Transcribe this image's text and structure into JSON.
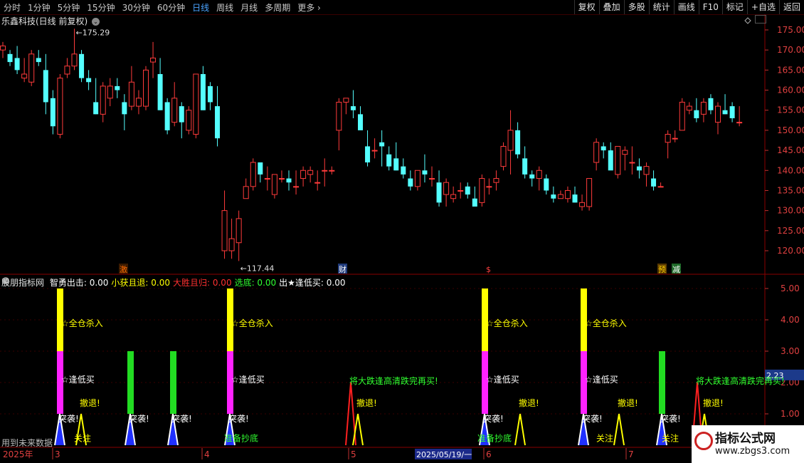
{
  "toolbar": {
    "timeframes": [
      "分时",
      "1分钟",
      "5分钟",
      "15分钟",
      "30分钟",
      "60分钟",
      "日线",
      "周线",
      "月线",
      "多周期",
      "更多"
    ],
    "active": "日线",
    "buttons": [
      "复权",
      "叠加",
      "多股",
      "统计",
      "画线",
      "F10",
      "标记",
      "+自选",
      "返回"
    ]
  },
  "title": "乐鑫科技(日线 前复权)",
  "main_chart": {
    "y_ticks": [
      "175.00",
      "170.00",
      "165.00",
      "160.00",
      "155.00",
      "150.00",
      "145.00",
      "140.00",
      "135.00",
      "130.00",
      "125.00",
      "120.00"
    ],
    "high_label": "175.29",
    "low_label": "117.44",
    "markers": [
      {
        "text": "激",
        "color": "#ff6a00",
        "bg": "#3a1a00"
      },
      {
        "text": "财",
        "color": "#ffffff",
        "bg": "#1f3a7a"
      },
      {
        "text": "$",
        "color": "#ff4040",
        "bg": "#000000"
      },
      {
        "text": "预",
        "color": "#ffd000",
        "bg": "#5a3a00"
      },
      {
        "text": "减",
        "color": "#ffffff",
        "bg": "#1f6a2a"
      }
    ]
  },
  "indicator": {
    "title": "股朋指标网",
    "items": [
      {
        "name": "智勇出击",
        "value": "0.00",
        "color": "#ffffff"
      },
      {
        "name": "小获且退",
        "value": "0.00",
        "color": "#ffff00"
      },
      {
        "name": "大胜且归",
        "value": "0.00",
        "color": "#ff3030"
      },
      {
        "name": "选底",
        "value": "0.00",
        "color": "#30ff30"
      },
      {
        "name": "出★逢低买",
        "value": "0.00",
        "color": "#ffffff"
      }
    ],
    "y_ticks": [
      "5.00",
      "4.00",
      "3.00",
      "2.00",
      "1.00"
    ],
    "current_value": "2.23",
    "labels": {
      "kill": "☆全仓杀入",
      "buy_low": "☆逢低买",
      "raid": "突袭!",
      "retreat": "撤退!",
      "attention": "关注",
      "bottom": "准备抄底",
      "crash": "将大跌逢高清跌完再买!"
    }
  },
  "time_axis": {
    "year": "2025年",
    "months": [
      "3",
      "4",
      "5",
      "6",
      "7"
    ],
    "cursor_date": "2025/05/19/一"
  },
  "bottom_hint": "用到未来数据",
  "watermark": {
    "line1": "指标公式网",
    "line2": "www.zbgs3.com"
  },
  "colors": {
    "up": "#ff3b3b",
    "down": "#54ffff",
    "grid": "#5a0000",
    "axis_text": "#e04040"
  },
  "chart_data": {
    "type": "candlestick",
    "ylim": [
      117,
      177
    ],
    "ohlc": [
      [
        170,
        172,
        168,
        171
      ],
      [
        169,
        170,
        166,
        167
      ],
      [
        168,
        171,
        164,
        165
      ],
      [
        163,
        168,
        162,
        164
      ],
      [
        162,
        170,
        161,
        169
      ],
      [
        168,
        170,
        166,
        167
      ],
      [
        165,
        169,
        154,
        157
      ],
      [
        158,
        160,
        149,
        151
      ],
      [
        149,
        164,
        148,
        163
      ],
      [
        164,
        168,
        163,
        166
      ],
      [
        166,
        175.29,
        165,
        169
      ],
      [
        169,
        170,
        162,
        163
      ],
      [
        163,
        165,
        160,
        162
      ],
      [
        157,
        163,
        154,
        154
      ],
      [
        154,
        162,
        152,
        161
      ],
      [
        158,
        163,
        156,
        161
      ],
      [
        161,
        163,
        158,
        160
      ],
      [
        157,
        159,
        150,
        154
      ],
      [
        156,
        166,
        155,
        162
      ],
      [
        156,
        160,
        154,
        158
      ],
      [
        156,
        166,
        155,
        165
      ],
      [
        167,
        172,
        163,
        168
      ],
      [
        164,
        168,
        155,
        155
      ],
      [
        157,
        158,
        149,
        150
      ],
      [
        152,
        162,
        151,
        158
      ],
      [
        156,
        157,
        148,
        152
      ],
      [
        150,
        156,
        149,
        155
      ],
      [
        149,
        163,
        148,
        164
      ],
      [
        164,
        166,
        155,
        155
      ],
      [
        161,
        162,
        155,
        157
      ],
      [
        156,
        161,
        146,
        148
      ],
      [
        120,
        135,
        118,
        130
      ],
      [
        120,
        128,
        118,
        123
      ],
      [
        122,
        130,
        117.44,
        128
      ],
      [
        133,
        138,
        133,
        136
      ],
      [
        136,
        143,
        135,
        142
      ],
      [
        142,
        142,
        137,
        139
      ],
      [
        138,
        141,
        135,
        138
      ],
      [
        134,
        139,
        133,
        139
      ],
      [
        138,
        140,
        137,
        138
      ],
      [
        138,
        140,
        135,
        137
      ],
      [
        136,
        140,
        134,
        136
      ],
      [
        138,
        141,
        136,
        140
      ],
      [
        139,
        141,
        137,
        140
      ],
      [
        137,
        140,
        135,
        137
      ],
      [
        140,
        143,
        136,
        140
      ],
      [
        140,
        141,
        139,
        140
      ],
      [
        150,
        158,
        145,
        157
      ],
      [
        157,
        158,
        154,
        158
      ],
      [
        156,
        160,
        153,
        155
      ],
      [
        154,
        156,
        151,
        150
      ],
      [
        146,
        150,
        141,
        142
      ],
      [
        145,
        148,
        143,
        145
      ],
      [
        147,
        150,
        141,
        146
      ],
      [
        144,
        146,
        140,
        141
      ],
      [
        143,
        147,
        140,
        140
      ],
      [
        141,
        143,
        138,
        139
      ],
      [
        138,
        140,
        135,
        136
      ],
      [
        136,
        140,
        135,
        140
      ],
      [
        140,
        144,
        137,
        139
      ],
      [
        138,
        141,
        136,
        138
      ],
      [
        137,
        140,
        131,
        132
      ],
      [
        134,
        138,
        131,
        137
      ],
      [
        133,
        136,
        132,
        134
      ],
      [
        135,
        137,
        133,
        135
      ],
      [
        136,
        137,
        133,
        134
      ],
      [
        133,
        136,
        131,
        131
      ],
      [
        132,
        139,
        131,
        138
      ],
      [
        136,
        138,
        134,
        136
      ],
      [
        137,
        140,
        135,
        138
      ],
      [
        141,
        147,
        140,
        146
      ],
      [
        145,
        155,
        139,
        150
      ],
      [
        150,
        152,
        143,
        144
      ],
      [
        143,
        146,
        138,
        139
      ],
      [
        139,
        140,
        136,
        138
      ],
      [
        138,
        141,
        135,
        140
      ],
      [
        138,
        139,
        134,
        135
      ],
      [
        134,
        136,
        132,
        133
      ],
      [
        133,
        135,
        133,
        134
      ],
      [
        133,
        136,
        132,
        135
      ],
      [
        134,
        136,
        132,
        132
      ],
      [
        131,
        134,
        130,
        132
      ],
      [
        131,
        137,
        130,
        138
      ],
      [
        142,
        148,
        140,
        147
      ],
      [
        146,
        147,
        143,
        145
      ],
      [
        145,
        147,
        141,
        140
      ],
      [
        139,
        146,
        138,
        146
      ],
      [
        144,
        146,
        140,
        145
      ],
      [
        142,
        146,
        139,
        142
      ],
      [
        141,
        143,
        138,
        140
      ],
      [
        139,
        142,
        136,
        141
      ],
      [
        138,
        140,
        135,
        136
      ],
      [
        136,
        137,
        136,
        136
      ],
      [
        147,
        150,
        143,
        149
      ],
      [
        148,
        150,
        147,
        148
      ],
      [
        150,
        158,
        150,
        157
      ],
      [
        155,
        157,
        154,
        156
      ],
      [
        155,
        158,
        152,
        153
      ],
      [
        154,
        158,
        152,
        157
      ],
      [
        158,
        159,
        154,
        155
      ],
      [
        152,
        157,
        149,
        156
      ],
      [
        155,
        159,
        154,
        154
      ],
      [
        156,
        157,
        152,
        153
      ],
      [
        152,
        156,
        151,
        152
      ]
    ],
    "indicator_events": [
      {
        "x": 84,
        "type": "kill"
      },
      {
        "x": 183,
        "type": "green"
      },
      {
        "x": 243,
        "type": "green"
      },
      {
        "x": 323,
        "type": "kill_bottom"
      },
      {
        "x": 493,
        "type": "crash"
      },
      {
        "x": 681,
        "type": "kill_bottom2"
      },
      {
        "x": 820,
        "type": "kill_attn"
      },
      {
        "x": 930,
        "type": "green_attn"
      },
      {
        "x": 980,
        "type": "crash2"
      }
    ]
  }
}
